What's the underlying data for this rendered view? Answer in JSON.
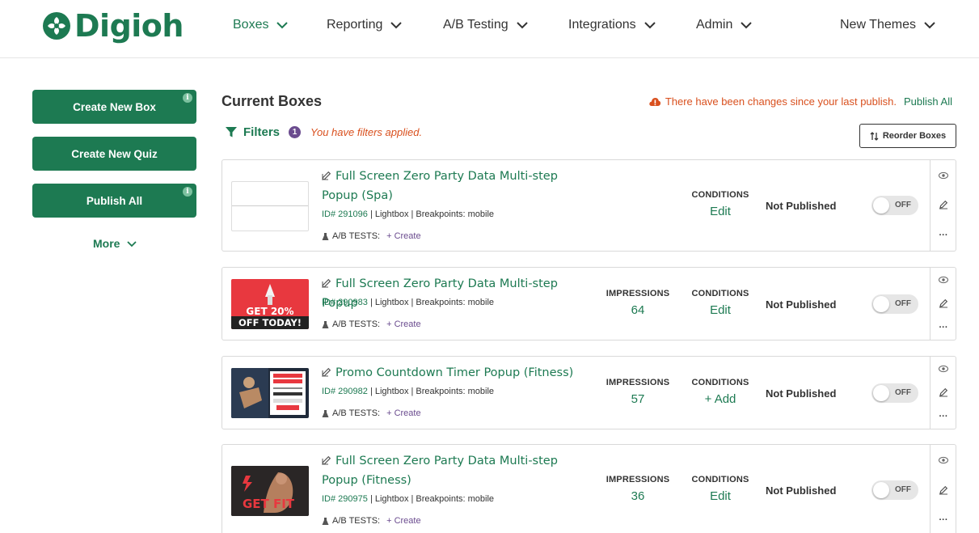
{
  "brand": {
    "name": "Digioh",
    "color": "#1d7a52"
  },
  "nav": {
    "boxes": "Boxes",
    "reporting": "Reporting",
    "ab_testing": "A/B Testing",
    "integrations": "Integrations",
    "admin": "Admin",
    "new_themes": "New Themes"
  },
  "sidebar": {
    "create_box": "Create New Box",
    "create_quiz": "Create New Quiz",
    "publish_all": "Publish All",
    "info_glyph": "i",
    "more": "More"
  },
  "main": {
    "title": "Current Boxes",
    "alert_text": "There have been changes since your last publish.",
    "alert_link": "Publish All",
    "filters_label": "Filters",
    "filters_count": "1",
    "filters_applied": "You have filters applied.",
    "reorder_label": "Reorder Boxes"
  },
  "labels": {
    "impressions": "IMPRESSIONS",
    "conditions": "CONDITIONS",
    "ab_tests": "A/B TESTS:",
    "create": "+ Create",
    "toggle_off": "OFF",
    "more_glyph": "···"
  },
  "boxes": [
    {
      "title": "Full Screen Zero Party Data Multi-step Popup (Spa)",
      "id": "ID# 291096",
      "details": " | Lightbox | Breakpoints: mobile",
      "impressions": "",
      "conditions_action": "Edit",
      "status": "Not Published",
      "thumb": "blank"
    },
    {
      "title": "Full Screen Zero Party Data Multi-step Popup",
      "id": "ID# 290983",
      "details": " | Lightbox | Breakpoints: mobile",
      "impressions": "64",
      "conditions_action": "Edit",
      "status": "Not Published",
      "thumb": "GET 20% OFF TODAY!"
    },
    {
      "title": "Promo Countdown Timer Popup (Fitness)",
      "id": "ID# 290982",
      "details": " | Lightbox | Breakpoints: mobile",
      "impressions": "57",
      "conditions_action": "+ Add",
      "status": "Not Published",
      "thumb": "DON'T MISS THIS OFFER!"
    },
    {
      "title": "Full Screen Zero Party Data Multi-step Popup (Fitness)",
      "id": "ID# 290975",
      "details": " | Lightbox | Breakpoints: mobile",
      "impressions": "36",
      "conditions_action": "Edit",
      "status": "Not Published",
      "thumb": "GET FIT"
    }
  ]
}
